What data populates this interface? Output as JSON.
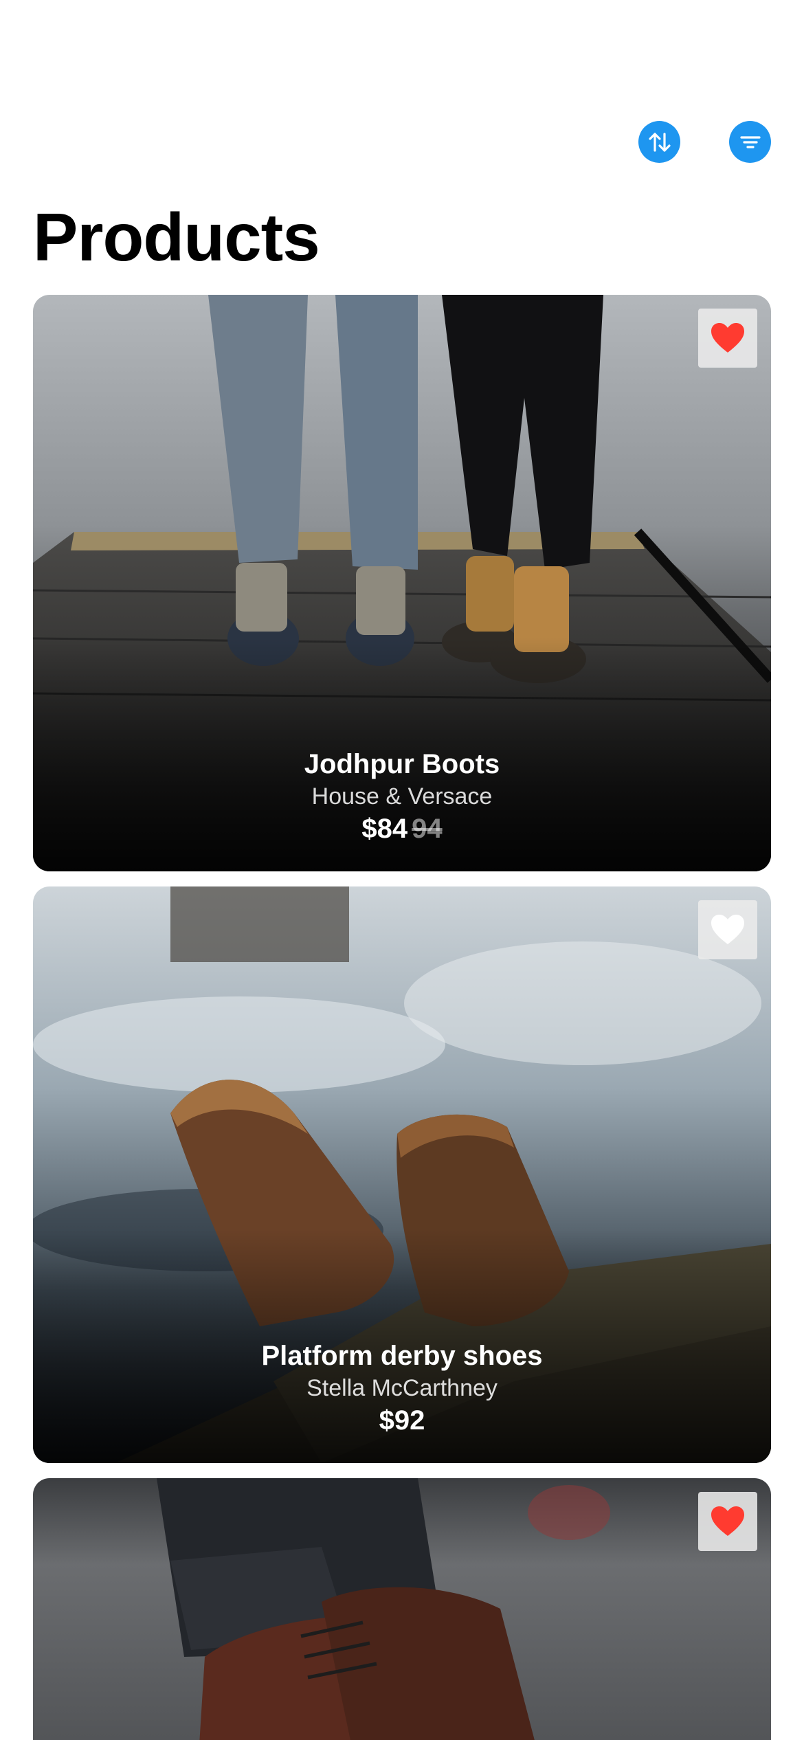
{
  "header": {
    "title": "Products",
    "sort_icon": "sort-arrows-icon",
    "filter_icon": "filter-lines-icon"
  },
  "colors": {
    "accent": "#1e96f0",
    "favorite_active": "#ff3b30",
    "favorite_inactive": "#ffffff"
  },
  "products": [
    {
      "name": "Jodhpur Boots",
      "brand": "House & Versace",
      "price": "$84",
      "old_price": "94",
      "favorited": true
    },
    {
      "name": "Platform derby shoes",
      "brand": "Stella McCarthney",
      "price": "$92",
      "old_price": "",
      "favorited": false
    },
    {
      "favorited": true
    }
  ]
}
